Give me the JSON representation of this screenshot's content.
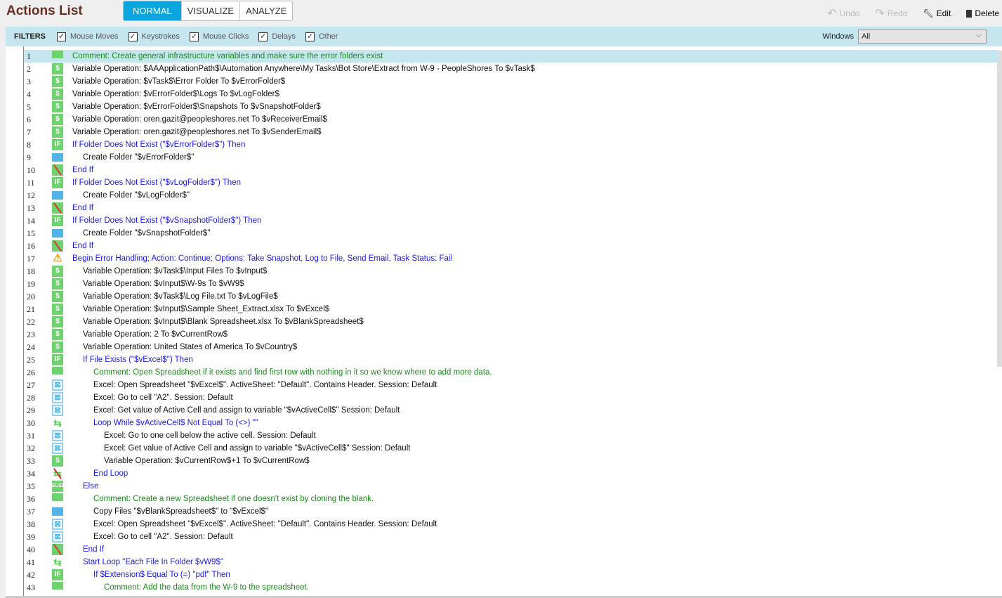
{
  "header": {
    "title": "Actions List",
    "modes": [
      "NORMAL",
      "VISUALIZE",
      "ANALYZE"
    ],
    "undo": "Undo",
    "redo": "Redo",
    "edit": "Edit",
    "delete": "Delete"
  },
  "filters": {
    "label": "FILTERS",
    "items": [
      "Mouse Moves",
      "Keystrokes",
      "Mouse Clicks",
      "Delays",
      "Other"
    ],
    "windows_label": "Windows",
    "windows_value": "All"
  },
  "rows": [
    {
      "n": "1",
      "icon": "comment",
      "indent": 0,
      "kind": "comment",
      "text": "Comment: Create general infrastructure variables and make sure the error folders exist"
    },
    {
      "n": "2",
      "icon": "dollar",
      "indent": 0,
      "kind": "plain",
      "text": "Variable Operation: $AAApplicationPath$\\Automation Anywhere\\My Tasks\\Bot Store\\Extract from W-9 - PeopleShores To $vTask$"
    },
    {
      "n": "3",
      "icon": "dollar",
      "indent": 0,
      "kind": "plain",
      "text": "Variable Operation: $vTask$\\Error Folder To $vErrorFolder$"
    },
    {
      "n": "4",
      "icon": "dollar",
      "indent": 0,
      "kind": "plain",
      "text": "Variable Operation: $vErrorFolder$\\Logs To $vLogFolder$"
    },
    {
      "n": "5",
      "icon": "dollar",
      "indent": 0,
      "kind": "plain",
      "text": "Variable Operation: $vErrorFolder$\\Snapshots To $vSnapshotFolder$"
    },
    {
      "n": "6",
      "icon": "dollar",
      "indent": 0,
      "kind": "plain",
      "text": "Variable Operation: oren.gazit@peopleshores.net To $vReceiverEmail$"
    },
    {
      "n": "7",
      "icon": "dollar",
      "indent": 0,
      "kind": "plain",
      "text": "Variable Operation: oren.gazit@peopleshores.net To $vSenderEmail$"
    },
    {
      "n": "8",
      "icon": "if",
      "indent": 0,
      "kind": "control",
      "text": "If Folder Does Not Exist (\"$vErrorFolder$\")  Then"
    },
    {
      "n": "9",
      "icon": "folder",
      "indent": 1,
      "kind": "plain",
      "text": "Create Folder \"$vErrorFolder$\""
    },
    {
      "n": "10",
      "icon": "endif",
      "indent": 0,
      "kind": "control",
      "text": "End If"
    },
    {
      "n": "11",
      "icon": "if",
      "indent": 0,
      "kind": "control",
      "text": "If Folder Does Not Exist (\"$vLogFolder$\")  Then"
    },
    {
      "n": "12",
      "icon": "folder",
      "indent": 1,
      "kind": "plain",
      "text": "Create Folder \"$vLogFolder$\""
    },
    {
      "n": "13",
      "icon": "endif",
      "indent": 0,
      "kind": "control",
      "text": "End If"
    },
    {
      "n": "14",
      "icon": "if",
      "indent": 0,
      "kind": "control",
      "text": "If Folder Does Not Exist (\"$vSnapshotFolder$\")  Then"
    },
    {
      "n": "15",
      "icon": "folder",
      "indent": 1,
      "kind": "plain",
      "text": "Create Folder \"$vSnapshotFolder$\""
    },
    {
      "n": "16",
      "icon": "endif",
      "indent": 0,
      "kind": "control",
      "text": "End If"
    },
    {
      "n": "17",
      "icon": "warning",
      "indent": 0,
      "kind": "control",
      "text": "Begin Error Handling; Action: Continue; Options: Take Snapshot, Log to File, Send Email,  Task Status: Fail"
    },
    {
      "n": "18",
      "icon": "dollar",
      "indent": 1,
      "kind": "plain",
      "text": "Variable Operation: $vTask$\\Input Files To $vInput$"
    },
    {
      "n": "19",
      "icon": "dollar",
      "indent": 1,
      "kind": "plain",
      "text": "Variable Operation: $vInput$\\W-9s To $vW9$"
    },
    {
      "n": "20",
      "icon": "dollar",
      "indent": 1,
      "kind": "plain",
      "text": "Variable Operation: $vTask$\\Log File.txt To $vLogFile$"
    },
    {
      "n": "21",
      "icon": "dollar",
      "indent": 1,
      "kind": "plain",
      "text": "Variable Operation: $vInput$\\Sample Sheet_Extract.xlsx To $vExcel$"
    },
    {
      "n": "22",
      "icon": "dollar",
      "indent": 1,
      "kind": "plain",
      "text": "Variable Operation: $vInput$\\Blank Spreadsheet.xlsx To $vBlankSpreadsheet$"
    },
    {
      "n": "23",
      "icon": "dollar",
      "indent": 1,
      "kind": "plain",
      "text": "Variable Operation: 2 To $vCurrentRow$"
    },
    {
      "n": "24",
      "icon": "dollar",
      "indent": 1,
      "kind": "plain",
      "text": "Variable Operation: United States of America To $vCountry$"
    },
    {
      "n": "25",
      "icon": "if",
      "indent": 1,
      "kind": "control",
      "text": "If File Exists (\"$vExcel$\")  Then"
    },
    {
      "n": "26",
      "icon": "comment",
      "indent": 2,
      "kind": "comment",
      "text": "Comment: Open Spreadsheet if it exists and find first row with nothing in it so we know where to add more data."
    },
    {
      "n": "27",
      "icon": "excel",
      "indent": 2,
      "kind": "plain",
      "text": "Excel: Open Spreadsheet \"$vExcel$\". ActiveSheet: \"Default\". Contains Header. Session: Default"
    },
    {
      "n": "28",
      "icon": "excel",
      "indent": 2,
      "kind": "plain",
      "text": "Excel: Go to cell \"A2\". Session: Default"
    },
    {
      "n": "29",
      "icon": "excel",
      "indent": 2,
      "kind": "plain",
      "text": "Excel: Get value of Active Cell and assign to variable \"$vActiveCell$\" Session: Default"
    },
    {
      "n": "30",
      "icon": "loop",
      "indent": 2,
      "kind": "control",
      "text": "Loop While $vActiveCell$ Not Equal To (<>) \"\""
    },
    {
      "n": "31",
      "icon": "excel",
      "indent": 3,
      "kind": "plain",
      "text": "Excel: Go to one cell below the active cell. Session: Default"
    },
    {
      "n": "32",
      "icon": "excel",
      "indent": 3,
      "kind": "plain",
      "text": "Excel: Get value of Active Cell and assign to variable \"$vActiveCell$\" Session: Default"
    },
    {
      "n": "33",
      "icon": "dollar",
      "indent": 3,
      "kind": "plain",
      "text": "Variable Operation: $vCurrentRow$+1 To $vCurrentRow$"
    },
    {
      "n": "34",
      "icon": "endloop",
      "indent": 2,
      "kind": "control",
      "text": "End Loop"
    },
    {
      "n": "35",
      "icon": "else",
      "indent": 1,
      "kind": "control",
      "text": "Else"
    },
    {
      "n": "36",
      "icon": "comment",
      "indent": 2,
      "kind": "comment",
      "text": "Comment: Create a new Spreadsheet if one doesn't exist by cloning the blank."
    },
    {
      "n": "37",
      "icon": "folder",
      "indent": 2,
      "kind": "plain",
      "text": "Copy Files \"$vBlankSpreadsheet$\" to \"$vExcel$\""
    },
    {
      "n": "38",
      "icon": "excel",
      "indent": 2,
      "kind": "plain",
      "text": "Excel: Open Spreadsheet \"$vExcel$\". ActiveSheet: \"Default\". Contains Header. Session: Default"
    },
    {
      "n": "39",
      "icon": "excel",
      "indent": 2,
      "kind": "plain",
      "text": "Excel: Go to cell \"A2\". Session: Default"
    },
    {
      "n": "40",
      "icon": "endif",
      "indent": 1,
      "kind": "control",
      "text": "End If"
    },
    {
      "n": "41",
      "icon": "loop",
      "indent": 1,
      "kind": "control",
      "text": "Start Loop \"Each File In Folder $vW9$\""
    },
    {
      "n": "42",
      "icon": "if",
      "indent": 2,
      "kind": "control",
      "text": "If $Extension$ Equal To (=) \"pdf\" Then"
    },
    {
      "n": "43",
      "icon": "comment",
      "indent": 3,
      "kind": "comment",
      "text": "Comment: Add the data from the W-9 to the spreadsheet."
    }
  ]
}
